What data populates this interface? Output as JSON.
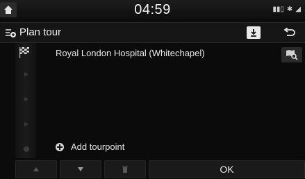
{
  "status": {
    "time": "04:59"
  },
  "titlebar": {
    "title": "Plan tour"
  },
  "route": {
    "destination": "Royal London Hospital (Whitechapel)",
    "add_tourpoint_label": "Add tourpoint"
  },
  "bottom": {
    "ok_label": "OK"
  },
  "icons": {
    "home": "home-icon",
    "tour": "tour-icon",
    "save": "save-icon",
    "back": "back-icon",
    "flag": "checkered-flag-icon",
    "map": "map-search-icon",
    "add": "plus-circle-icon",
    "up": "arrow-up-icon",
    "down": "arrow-down-icon",
    "delete": "trash-icon"
  }
}
